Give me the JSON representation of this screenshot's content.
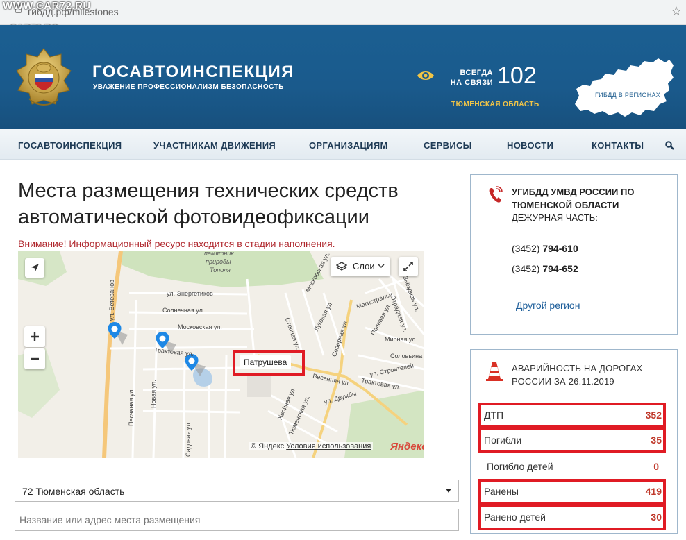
{
  "browser": {
    "url": "гибдд.рф/milestones",
    "watermark_top": "WWW.CAR72.RU",
    "watermark_logo": "CAR72.RO"
  },
  "header": {
    "title": "ГОСАВТОИНСПЕКЦИЯ",
    "subtitle": "УВАЖЕНИЕ ПРОФЕССИОНАЛИЗМ БЕЗОПАСНОСТЬ",
    "always_line1": "ВСЕГДА",
    "always_line2": "НА СВЯЗИ",
    "phone": "102",
    "region": "ТЮМЕНСКАЯ ОБЛАСТЬ",
    "regions_map_label": "ГИБДД В РЕГИОНАХ"
  },
  "nav": {
    "items": [
      "ГОСАВТОИНСПЕКЦИЯ",
      "УЧАСТНИКАМ ДВИЖЕНИЯ",
      "ОРГАНИЗАЦИЯМ",
      "СЕРВИСЫ",
      "НОВОСТИ",
      "КОНТАКТЫ"
    ]
  },
  "main": {
    "title": "Места размещения технических средств автоматической фотовидеофиксации",
    "warning": "Внимание! Информационный ресурс находится в стадии наполнения."
  },
  "map": {
    "layers_label": "Слои",
    "callout": "Патрушева",
    "copyright_prefix": "© Яндекс",
    "terms_link": "Условия использования",
    "yandex_logo": "Яндекс",
    "park_label_1": "памятник",
    "park_label_2": "природы",
    "park_label_3": "Тополя",
    "streets": {
      "energetikov": "ул. Энергетиков",
      "solnechnaya": "Солнечная ул.",
      "moskovskaya": "Московская ул.",
      "traktovaya": "Трактовая ул.",
      "veteranov": "ул. Ветеранов",
      "peschanaya": "Песчаная ул.",
      "novaya": "Новая ул.",
      "sadovaya": "Садовая ул.",
      "moskovskaya2": "Московская ул.",
      "lugovaya": "Луговая ул.",
      "stepnaya": "Степная ул.",
      "severnaya": "Северная ул.",
      "magistralnaya": "Магистральн",
      "zvezdnaya": "Звёздная ул.",
      "otradnaya": "Отрадная ул.",
      "polevaya": "Полевая ул.",
      "mirnaya": "Мирная ул.",
      "solovyinaya": "Соловьина",
      "stroiteley": "ул. Строителей",
      "traktovaya2": "Трактовая ул.",
      "vesennyaya": "Весенняя ул.",
      "druzhby": "ул. Дружбы",
      "khvoynaya": "Хвойная ул.",
      "tyumenskaya": "Тюменская ул."
    }
  },
  "filters": {
    "region_selected": "72 Тюменская область",
    "search_placeholder": "Название или адрес места размещения"
  },
  "contact": {
    "org_name": "УГИБДД УМВД РОССИИ ПО ТЮМЕНСКОЙ ОБЛАСТИ",
    "duty": "ДЕЖУРНАЯ ЧАСТЬ:",
    "phone1_code": "(3452)",
    "phone1_num": "794-610",
    "phone2_code": "(3452)",
    "phone2_num": "794-652",
    "other_region": "Другой регион"
  },
  "stats": {
    "title": "АВАРИЙНОСТЬ НА ДОРОГАХ РОССИИ ЗА 26.11.2019",
    "rows": [
      {
        "label": "ДТП",
        "value": "352"
      },
      {
        "label": "Погибли",
        "value": "35"
      },
      {
        "label": "Погибло детей",
        "value": "0"
      },
      {
        "label": "Ранены",
        "value": "419"
      },
      {
        "label": "Ранено детей",
        "value": "30"
      }
    ]
  },
  "colors": {
    "header_blue": "#1a5a8c",
    "accent_gold": "#f0c447",
    "alert_red": "#e01b24",
    "stat_value_red": "#c0392b",
    "link_blue": "#1d5e9a"
  }
}
